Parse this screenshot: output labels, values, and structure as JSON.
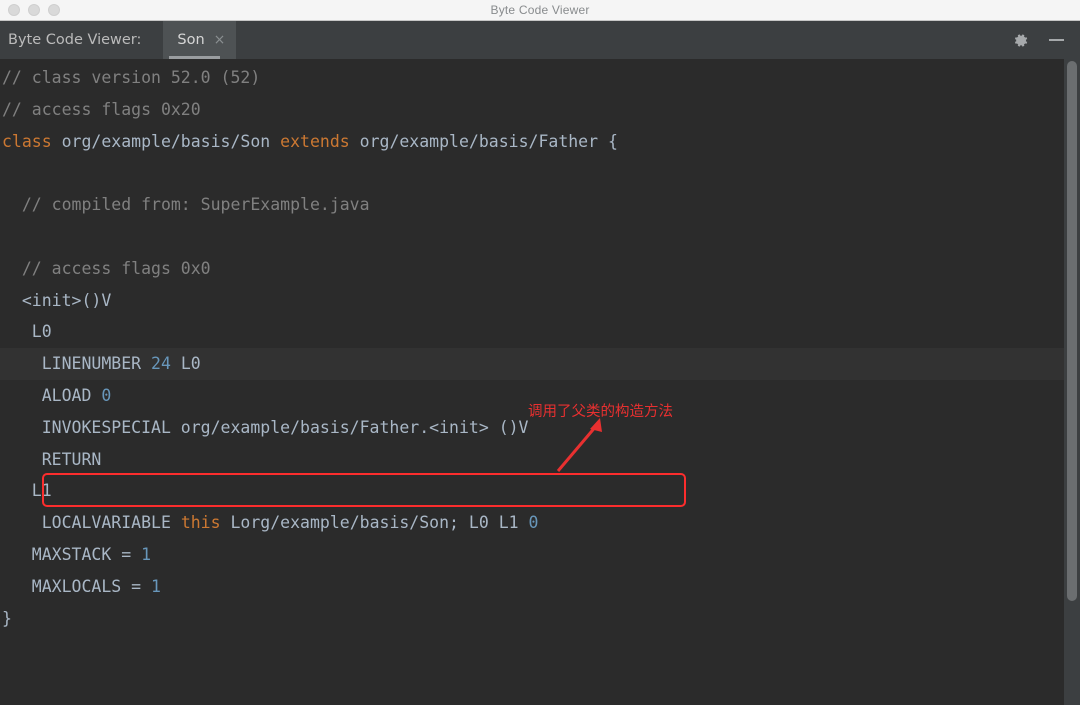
{
  "window": {
    "title": "Byte Code Viewer",
    "traffic_lights": [
      "close",
      "minimize",
      "zoom"
    ]
  },
  "toolbar": {
    "label": "Byte Code Viewer:",
    "tab": {
      "label": "Son",
      "close_glyph": "×"
    },
    "settings_icon": "gear-icon",
    "minimize_icon": "minimize-icon"
  },
  "editor": {
    "lines": [
      {
        "id": "l1",
        "highlight": false,
        "segments": [
          {
            "cls": "cmt",
            "text": "// class version 52.0 (52)"
          }
        ]
      },
      {
        "id": "l2",
        "highlight": false,
        "segments": [
          {
            "cls": "cmt",
            "text": "// access flags 0x20"
          }
        ]
      },
      {
        "id": "l3",
        "highlight": false,
        "segments": [
          {
            "cls": "kw",
            "text": "class"
          },
          {
            "cls": "txt",
            "text": " org/example/basis/Son "
          },
          {
            "cls": "kw",
            "text": "extends"
          },
          {
            "cls": "txt",
            "text": " org/example/basis/Father {"
          }
        ]
      },
      {
        "id": "l4",
        "highlight": false,
        "segments": [
          {
            "cls": "txt",
            "text": ""
          }
        ]
      },
      {
        "id": "l5",
        "highlight": false,
        "segments": [
          {
            "cls": "cmt",
            "text": "  // compiled from: SuperExample.java"
          }
        ]
      },
      {
        "id": "l6",
        "highlight": false,
        "segments": [
          {
            "cls": "txt",
            "text": ""
          }
        ]
      },
      {
        "id": "l7",
        "highlight": false,
        "segments": [
          {
            "cls": "cmt",
            "text": "  // access flags 0x0"
          }
        ]
      },
      {
        "id": "l8",
        "highlight": false,
        "segments": [
          {
            "cls": "txt",
            "text": "  <init>()V"
          }
        ]
      },
      {
        "id": "l9",
        "highlight": false,
        "segments": [
          {
            "cls": "txt",
            "text": "   L0"
          }
        ]
      },
      {
        "id": "l10",
        "highlight": true,
        "segments": [
          {
            "cls": "txt",
            "text": "    LINENUMBER "
          },
          {
            "cls": "num",
            "text": "24"
          },
          {
            "cls": "txt",
            "text": " L0"
          }
        ]
      },
      {
        "id": "l11",
        "highlight": false,
        "segments": [
          {
            "cls": "txt",
            "text": "    ALOAD "
          },
          {
            "cls": "num",
            "text": "0"
          }
        ]
      },
      {
        "id": "l12",
        "highlight": false,
        "segments": [
          {
            "cls": "txt",
            "text": "    INVOKESPECIAL org/example/basis/Father.<init> ()V"
          }
        ]
      },
      {
        "id": "l13",
        "highlight": false,
        "segments": [
          {
            "cls": "txt",
            "text": "    RETURN"
          }
        ]
      },
      {
        "id": "l14",
        "highlight": false,
        "segments": [
          {
            "cls": "txt",
            "text": "   L1"
          }
        ]
      },
      {
        "id": "l15",
        "highlight": false,
        "segments": [
          {
            "cls": "txt",
            "text": "    LOCALVARIABLE "
          },
          {
            "cls": "kw",
            "text": "this"
          },
          {
            "cls": "txt",
            "text": " Lorg/example/basis/Son; L0 L1 "
          },
          {
            "cls": "num",
            "text": "0"
          }
        ]
      },
      {
        "id": "l16",
        "highlight": false,
        "segments": [
          {
            "cls": "txt",
            "text": "   MAXSTACK = "
          },
          {
            "cls": "num",
            "text": "1"
          }
        ]
      },
      {
        "id": "l17",
        "highlight": false,
        "segments": [
          {
            "cls": "txt",
            "text": "   MAXLOCALS = "
          },
          {
            "cls": "num",
            "text": "1"
          }
        ]
      },
      {
        "id": "l18",
        "highlight": false,
        "segments": [
          {
            "cls": "txt",
            "text": "}"
          }
        ]
      }
    ]
  },
  "annotation": {
    "text": "调用了父类的构造方法",
    "color": "#e83030",
    "box_color": "#fc2d2d",
    "target_line": "INVOKESPECIAL org/example/basis/Father.<init> ()V"
  },
  "colors": {
    "editor_background": "#2b2b2b",
    "highlight_row": "#323232",
    "toolbar_background": "#3c3f41",
    "titlebar_background": "#f5f5f5",
    "keyword": "#cc7832",
    "comment": "#808080",
    "number": "#6897bb",
    "text": "#a9b7c6",
    "scrollbar_thumb": "#6b6e70"
  }
}
